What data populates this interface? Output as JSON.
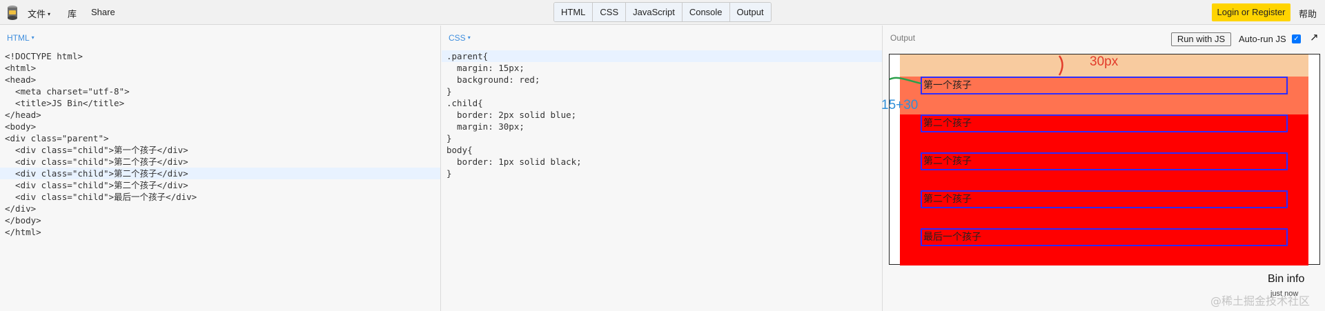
{
  "toolbar": {
    "menu": [
      {
        "label": "文件",
        "caret": "▾"
      },
      {
        "label": "库"
      },
      {
        "label": "Share"
      }
    ],
    "panels": [
      "HTML",
      "CSS",
      "JavaScript",
      "Console",
      "Output"
    ],
    "login_label": "Login or Register",
    "help_label": "帮助"
  },
  "html_panel": {
    "label": "HTML",
    "lines": [
      "<!DOCTYPE html>",
      "<html>",
      "<head>",
      "  <meta charset=\"utf-8\">",
      "  <title>JS Bin</title>",
      "</head>",
      "<body>",
      "<div class=\"parent\">",
      "  <div class=\"child\">第一个孩子</div>",
      "  <div class=\"child\">第二个孩子</div>",
      "  <div class=\"child\">第二个孩子</div>",
      "  <div class=\"child\">第二个孩子</div>",
      "  <div class=\"child\">最后一个孩子</div>",
      "</div>",
      "</body>",
      "</html>"
    ]
  },
  "css_panel": {
    "label": "CSS",
    "lines": [
      ".parent{",
      "  margin: 15px;",
      "  background: red;",
      "}",
      ".child{",
      "  border: 2px solid blue;",
      "  margin: 30px;",
      "}",
      "body{",
      "  border: 1px solid black;",
      "}"
    ]
  },
  "output_panel": {
    "label": "Output",
    "run_label": "Run with JS",
    "autorun_label": "Auto-run JS",
    "autorun_checked": true,
    "children": [
      "第一个孩子",
      "第二个孩子",
      "第二个孩子",
      "第二个孩子",
      "最后一个孩子"
    ],
    "annotation_margin": "30px",
    "annotation_sum": "15+30",
    "bin_info_title": "Bin info",
    "bin_info_sub": "just now"
  },
  "watermark": "@稀土掘金技术社区",
  "colors": {
    "accent_blue": "#3e8ede",
    "login_yellow": "#ffd400",
    "parent_red": "#ff0000",
    "margin_overlay": "#f8cb9f",
    "child_border": "#2c2cff"
  },
  "icons": {
    "logo": "jsbin-logo-icon",
    "popout": "popout-arrow-icon",
    "check": "checkbox-check-icon"
  }
}
